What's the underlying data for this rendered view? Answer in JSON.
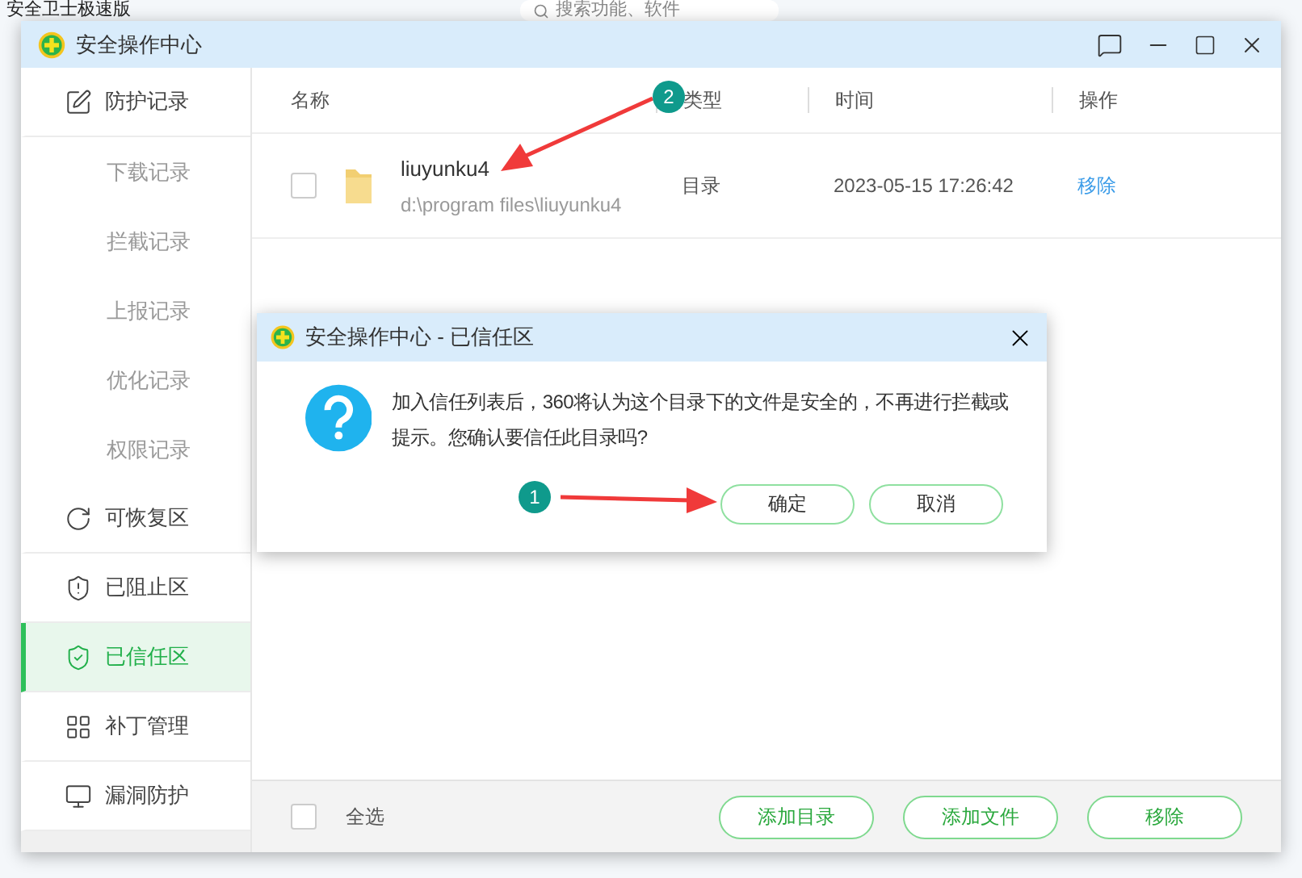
{
  "background_app": {
    "title": "安全卫士极速版",
    "search": {
      "placeholder": "搜索功能、软件"
    }
  },
  "window": {
    "title": "安全操作中心"
  },
  "sidebar": {
    "items": [
      {
        "label": "防护记录",
        "selected": false,
        "children": [
          {
            "label": "下载记录",
            "selected": false
          },
          {
            "label": "拦截记录",
            "selected": false
          },
          {
            "label": "上报记录",
            "selected": false
          },
          {
            "label": "优化记录",
            "selected": false
          },
          {
            "label": "权限记录",
            "selected": false
          }
        ]
      },
      {
        "label": "可恢复区",
        "selected": false
      },
      {
        "label": "已阻止区",
        "selected": false
      },
      {
        "label": "已信任区",
        "selected": true
      },
      {
        "label": "补丁管理",
        "selected": false
      },
      {
        "label": "漏洞防护",
        "selected": false
      }
    ]
  },
  "table": {
    "columns": [
      "名称",
      "类型",
      "时间",
      "操作"
    ],
    "rows": [
      {
        "checked": false,
        "name": "liuyunku4",
        "path": "d:\\program files\\liuyunku4",
        "type": "目录",
        "time": "2023-05-15 17:26:42",
        "action": "移除"
      }
    ]
  },
  "footer": {
    "select_all": {
      "label": "全选",
      "checked": false
    },
    "buttons": [
      "添加目录",
      "添加文件",
      "移除"
    ]
  },
  "dialog": {
    "title": "安全操作中心 - 已信任区",
    "message": "加入信任列表后，360将认为这个目录下的文件是安全的，不再进行拦截或提示。您确认要信任此目录吗?",
    "buttons": [
      "确定",
      "取消"
    ]
  },
  "annotations": [
    {
      "label": "1"
    },
    {
      "label": "2"
    }
  ]
}
